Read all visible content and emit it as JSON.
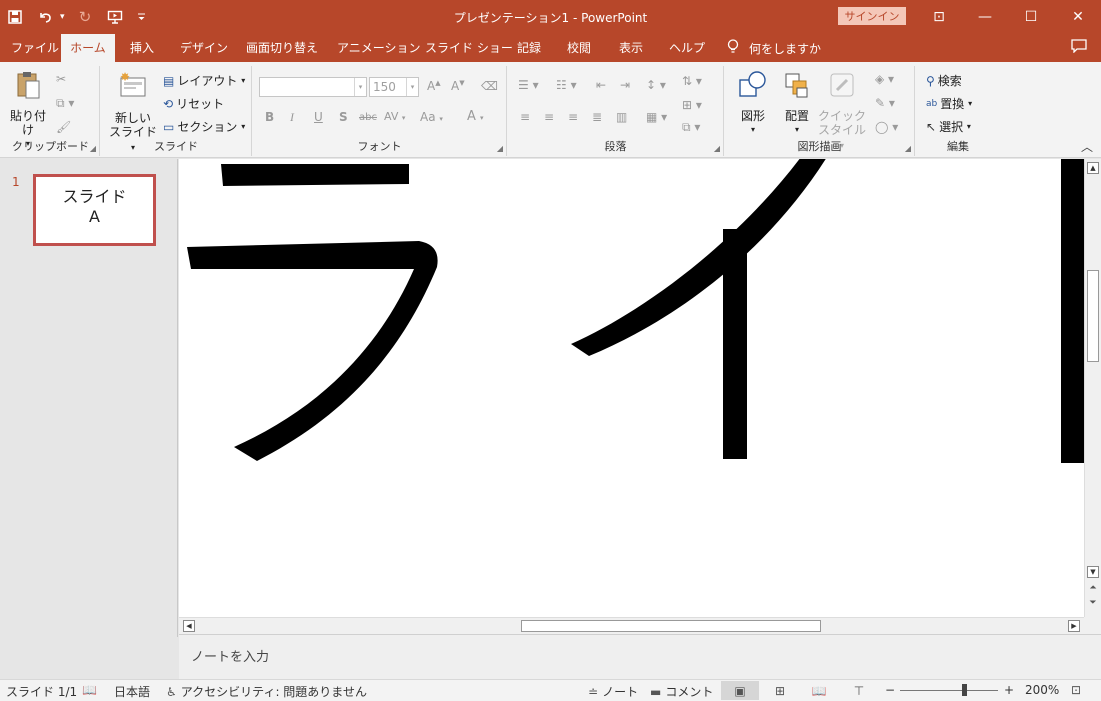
{
  "window": {
    "title": "プレゼンテーション1  -  PowerPoint",
    "signin": "サインイン",
    "minimize": "—",
    "restore": "☐",
    "close": "✕",
    "ribbon_display": "⊡"
  },
  "qat": {
    "save_icon": "save-icon",
    "undo_icon": "undo-icon",
    "redo_icon": "redo-icon",
    "present_icon": "start-from-beginning-icon",
    "customize_icon": "customize-qat-icon"
  },
  "tabs": [
    "ファイル",
    "ホーム",
    "挿入",
    "デザイン",
    "画面切り替え",
    "アニメーション",
    "スライド ショー",
    "記録",
    "校閲",
    "表示",
    "ヘルプ"
  ],
  "active_tab": "ホーム",
  "tell_me": "何をしますか",
  "ribbon": {
    "clipboard": {
      "label": "クリップボード",
      "paste": "貼り付け"
    },
    "slides": {
      "label": "スライド",
      "new_slide_1": "新しい",
      "new_slide_2": "スライド",
      "layout": "レイアウト",
      "reset": "リセット",
      "section": "セクション"
    },
    "font": {
      "label": "フォント",
      "font_name": "",
      "font_size": "150",
      "bold": "B",
      "italic": "I",
      "underline": "U",
      "shadow": "S",
      "strike": "abc",
      "spacing": "AV",
      "case": "Aa",
      "color": "A"
    },
    "paragraph": {
      "label": "段落"
    },
    "drawing": {
      "label": "図形描画",
      "shapes": "図形",
      "arrange": "配置",
      "quick_styles_1": "クイック",
      "quick_styles_2": "スタイル"
    },
    "editing": {
      "label": "編集",
      "find": "検索",
      "replace": "置換",
      "select": "選択"
    }
  },
  "thumbnails": [
    {
      "number": "1",
      "line1": "スライド",
      "line2": "A"
    }
  ],
  "slide": {
    "visible_text": "ライ"
  },
  "notes": {
    "placeholder": "ノートを入力"
  },
  "status": {
    "slide_counter": "スライド 1/1",
    "language": "日本語",
    "accessibility": "アクセシビリティ: 問題ありません",
    "notes": "ノート",
    "comments": "コメント",
    "zoom_minus": "−",
    "zoom_plus": "+",
    "zoom": "200%",
    "zoom_level_pct": 200
  },
  "colors": {
    "accent": "#b7472a",
    "thumb_border": "#c0504d"
  }
}
